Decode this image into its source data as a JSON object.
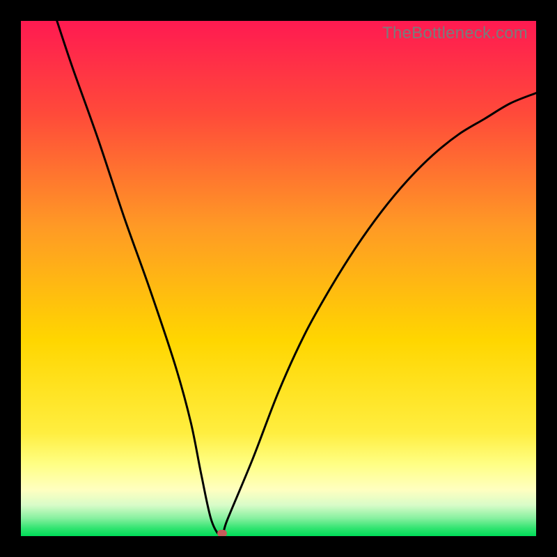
{
  "watermark": "TheBottleneck.com",
  "colors": {
    "top": "#FF1A51",
    "mid_upper": "#FF6B2F",
    "mid": "#FFD600",
    "yellow_band": "#FFFF84",
    "green_pale": "#A8F5A8",
    "green": "#00E45C",
    "curve": "#000000",
    "marker": "#C65B5B",
    "border": "#000000"
  },
  "chart_data": {
    "type": "line",
    "title": "",
    "xlabel": "",
    "ylabel": "",
    "xlim": [
      0,
      100
    ],
    "ylim": [
      0,
      100
    ],
    "grid": false,
    "legend": false,
    "series": [
      {
        "name": "bottleneck-curve",
        "x": [
          7,
          10,
          15,
          20,
          25,
          30,
          33,
          35,
          37,
          39,
          40,
          45,
          50,
          55,
          60,
          65,
          70,
          75,
          80,
          85,
          90,
          95,
          100
        ],
        "y": [
          100,
          91,
          77,
          62,
          48,
          33,
          22,
          12,
          3,
          0,
          3,
          15,
          28,
          39,
          48,
          56,
          63,
          69,
          74,
          78,
          81,
          84,
          86
        ]
      }
    ],
    "marker": {
      "x": 39,
      "y": 0.5
    }
  }
}
